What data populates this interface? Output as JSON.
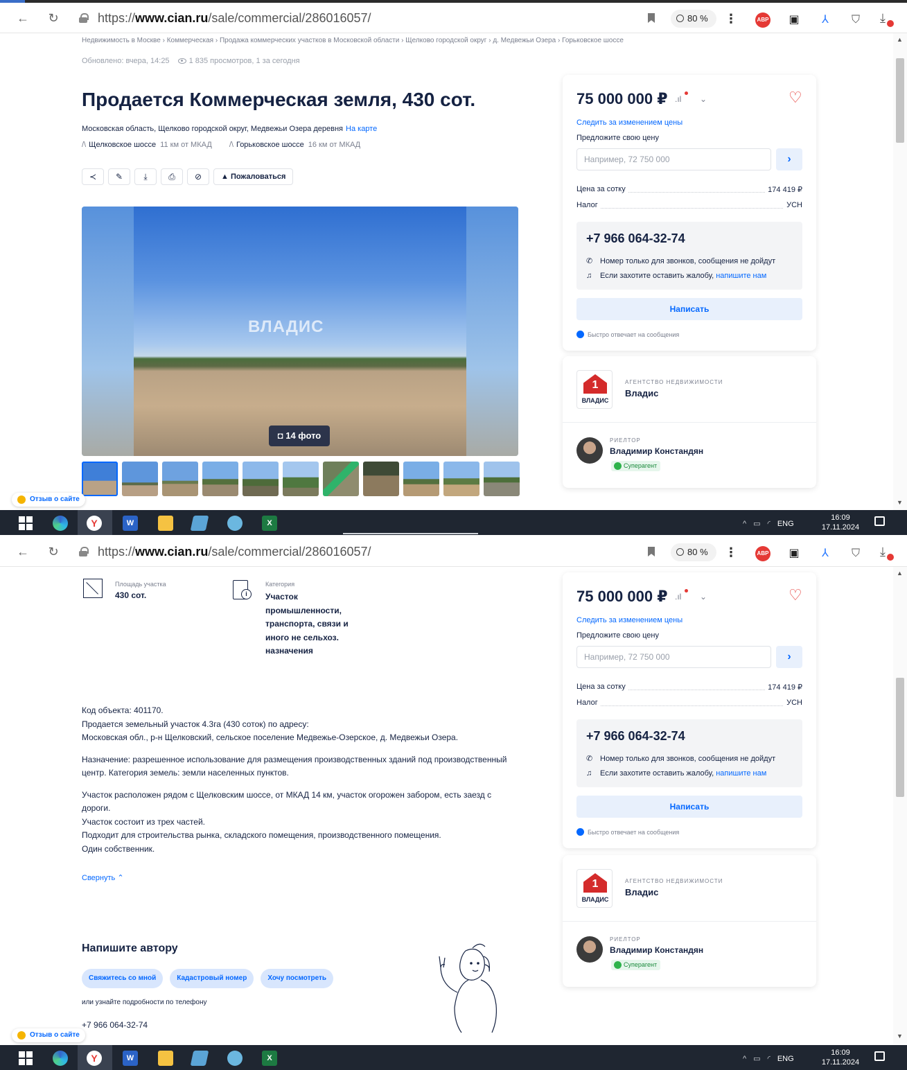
{
  "browser": {
    "url_prefix": "https://",
    "url_host": "www.cian.ru",
    "url_path": "/sale/commercial/286016057/",
    "zoom": "80 %",
    "abp": "ABP"
  },
  "breadcrumbs": "Недвижимость в Москве  ›  Коммерческая  ›  Продажа коммерческих участков в Московской области  ›  Щелково городской округ  ›  д. Медвежьи Озера  ›  Горьковское шоссе",
  "updated": "Обновлено: вчера, 14:25",
  "views": "1 835 просмотров, 1 за сегодня",
  "title": "Продается Коммерческая земля, 430 сот.",
  "address": "Московская область, Щелково городской округ, Медвежьи Озера деревня",
  "map_link": "На карте",
  "highways": [
    {
      "name": "Щелковское шоссе",
      "dist": "11 км от МКАД"
    },
    {
      "name": "Горьковское шоссе",
      "dist": "16 км от МКАД"
    }
  ],
  "actions": {
    "complain": "Пожаловаться"
  },
  "gallery": {
    "watermark": "ВЛАДИС",
    "photo_count": "14 фото"
  },
  "price_card": {
    "price": "75 000 000 ₽",
    "follow": "Следить за изменением цены",
    "offer_label": "Предложите свою цену",
    "offer_placeholder": "Например, 72 750 000",
    "price_per_label": "Цена за сотку",
    "price_per_value": "174 419 ₽",
    "tax_label": "Налог",
    "tax_value": "УСН",
    "phone": "+7 966 064-32-74",
    "note_calls": "Номер только для звонков, сообщения не дойдут",
    "note_complain": "Если захотите оставить жалобу,",
    "note_complain_link": "напишите нам",
    "write": "Написать",
    "fast_reply": "Быстро отвечает на сообщения"
  },
  "agency": {
    "logo_text": "ВЛАДИС",
    "logo_number": "1",
    "caption": "АГЕНТСТВО НЕДВИЖИМОСТИ",
    "name": "Владис",
    "realtor_caption": "РИЕЛТОР",
    "realtor_name": "Владимир Констандян",
    "badge": "Суперагент"
  },
  "feedback": "Отзыв о сайте",
  "taskbar": {
    "lang": "ENG",
    "time": "16:09",
    "date": "17.11.2024"
  },
  "details": {
    "area_caption": "Площадь участка",
    "area_value": "430 сот.",
    "category_caption": "Категория",
    "category_value": "Участок промышленности, транспорта, связи и иного не сельхоз. назначения"
  },
  "description": [
    "Код объекта: 401170.\n Продается земельный участок 4.3га (430 соток) по адресу:\nМосковская обл., р-н Щелковский, сельское поселение Медвежье-Озерское, д. Медвежьи Озера.",
    "Назначение: разрешенное использование для размещения производственных зданий под производственный центр. Категория земель: земли населенных пунктов.",
    "Участок расположен рядом с Щелковским шоссе, от МКАД 14 км, участок огорожен забором, есть заезд с дороги.\nУчасток состоит из трех частей.\nПодходит для строительства рынка, складского помещения, производственного помещения.\nОдин собственник."
  ],
  "collapse": "Свернуть",
  "write_author": {
    "title": "Напишите автору",
    "chips": [
      "Свяжитесь со мной",
      "Кадастровый номер",
      "Хочу посмотреть"
    ],
    "or_phone": "или узнайте подробности по телефону",
    "phone": "+7 966 064-32-74"
  },
  "colors": {
    "accent": "#0468ff",
    "text": "#152242",
    "heart": "#e53935"
  }
}
